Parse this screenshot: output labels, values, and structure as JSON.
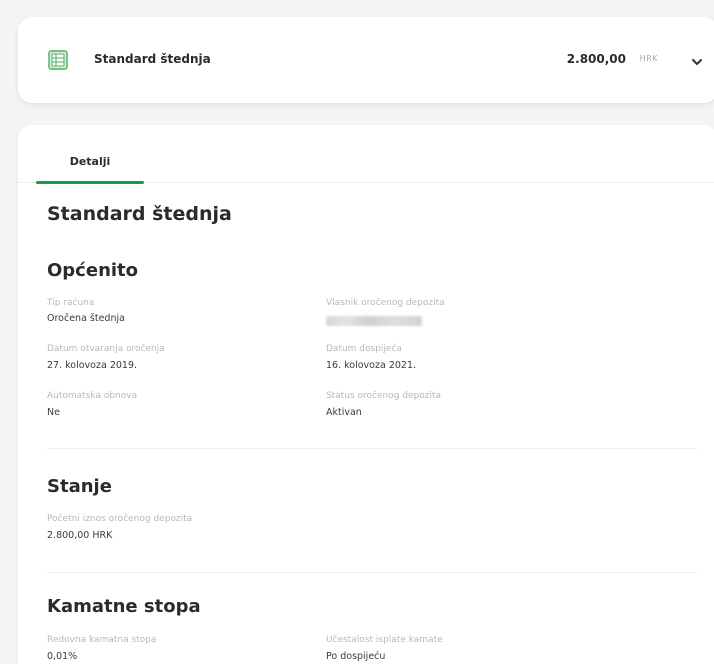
{
  "account": {
    "name": "Standard štednja",
    "amount": "2.800,00",
    "currency": "HRK",
    "icon": "ledger-icon",
    "accent_color": "#1c9a44"
  },
  "tabs": [
    {
      "label": "Detalji",
      "active": true
    }
  ],
  "page_title": "Standard štednja",
  "sections": {
    "general": {
      "title": "Općenito",
      "fields": {
        "account_type": {
          "label": "Tip računa",
          "value": "Oročena štednja"
        },
        "owner": {
          "label": "Vlasnik oročenog depozita",
          "value": ""
        },
        "open_date": {
          "label": "Datum otvaranja oročenja",
          "value": "27. kolovoza 2019."
        },
        "maturity_date": {
          "label": "Datum dospijeća",
          "value": "16. kolovoza 2021."
        },
        "auto_renewal": {
          "label": "Automatska obnova",
          "value": "Ne"
        },
        "status": {
          "label": "Status oročenog depozita",
          "value": "Aktivan"
        }
      }
    },
    "balance": {
      "title": "Stanje",
      "fields": {
        "initial_amount": {
          "label": "Početni iznos oročenog depozita",
          "value": "2.800,00 HRK"
        }
      }
    },
    "interest": {
      "title": "Kamatne stopa",
      "fields": {
        "regular_rate": {
          "label": "Redovna kamatna stopa",
          "value": "0,01%"
        },
        "payout_frequency": {
          "label": "Učestalost isplate kamate",
          "value": "Po dospijeću"
        }
      }
    }
  }
}
